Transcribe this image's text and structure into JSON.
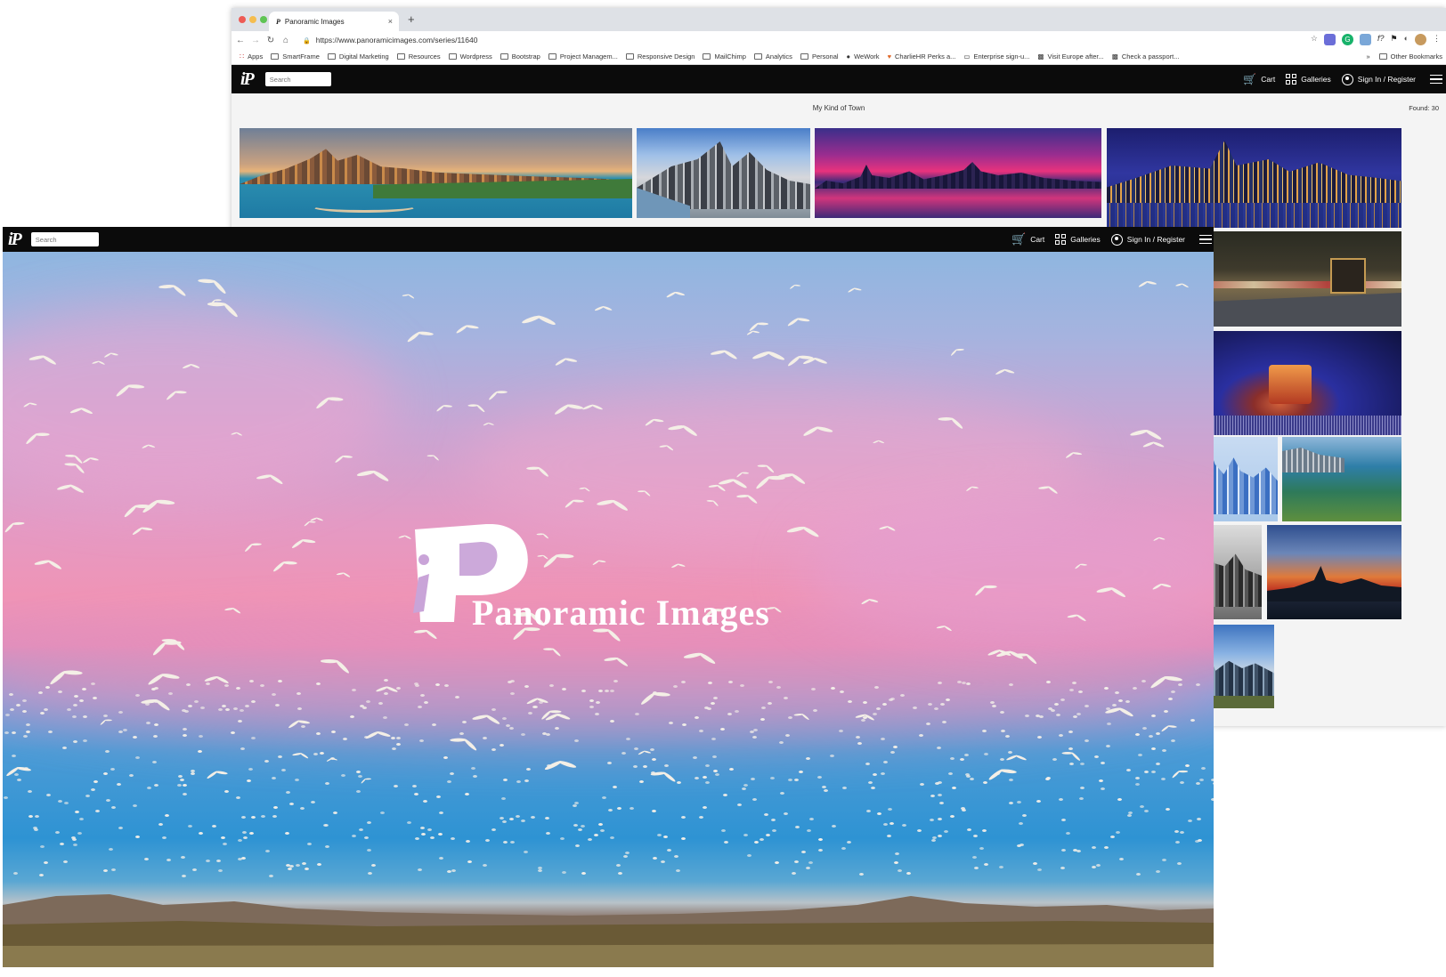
{
  "browser": {
    "tab_title": "Panoramic Images",
    "tab_close": "×",
    "new_tab": "+",
    "url": "https://www.panoramicimages.com/series/11640",
    "bookmarks": [
      "Apps",
      "SmartFrame",
      "Digital Marketing",
      "Resources",
      "Wordpress",
      "Bootstrap",
      "Project Managem...",
      "Responsive Design",
      "MailChimp",
      "Analytics",
      "Personal",
      "WeWork",
      "CharlieHR Perks a...",
      "Enterprise sign-u...",
      "Visit Europe after...",
      "Check a passport..."
    ],
    "bookmarks_overflow": "»",
    "other_bookmarks": "Other Bookmarks"
  },
  "site": {
    "logo": "iP",
    "search_placeholder": "Search",
    "nav": {
      "cart": "Cart",
      "galleries": "Galleries",
      "signin": "Sign In / Register"
    }
  },
  "series": {
    "title": "My Kind of Town",
    "found": "Found: 30"
  },
  "hero": {
    "brand_name": "Panoramic Images"
  },
  "colors": {
    "header_bg": "#0b0b0b",
    "page_bg": "#f4f4f4"
  }
}
